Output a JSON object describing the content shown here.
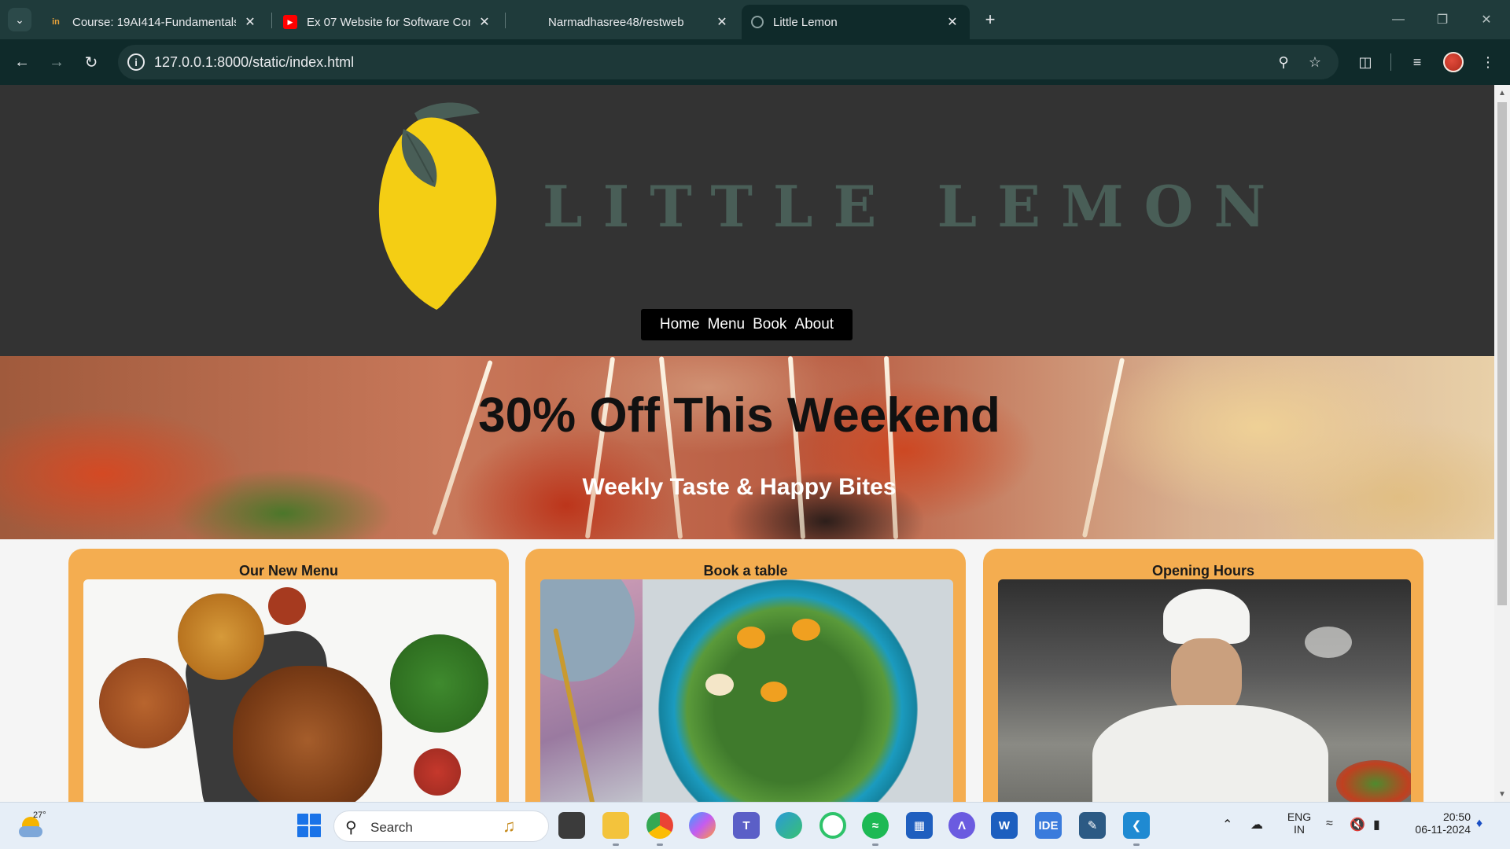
{
  "browser": {
    "tabs": [
      {
        "title": "Course: 19AI414-Fundamentals",
        "favicon": "coursera-in-icon",
        "active": false
      },
      {
        "title": "Ex 07 Website for Software Con",
        "favicon": "youtube-icon",
        "active": false
      },
      {
        "title": "Narmadhasree48/restweb",
        "favicon": "github-icon",
        "active": false
      },
      {
        "title": "Little Lemon",
        "favicon": "globe-icon",
        "active": true
      }
    ],
    "url": "127.0.0.1:8000/static/index.html"
  },
  "page": {
    "brand": "LITTLE LEMON",
    "nav": [
      "Home",
      "Menu",
      "Book",
      "About"
    ],
    "hero": {
      "title": "30% Off This Weekend",
      "subtitle": "Weekly Taste & Happy Bites"
    },
    "cards": [
      {
        "title": "Our New Menu"
      },
      {
        "title": "Book a table"
      },
      {
        "title": "Opening Hours"
      }
    ]
  },
  "taskbar": {
    "weather_temp": "27°",
    "search_label": "Search",
    "language_top": "ENG",
    "language_bottom": "IN",
    "time": "20:50",
    "date": "06-11-2024"
  },
  "colors": {
    "chrome_bg": "#1f3b3b",
    "header_bg": "#333333",
    "brand_green": "#495e57",
    "lemon_yellow": "#f4ce14",
    "card_orange": "#f4ad50"
  }
}
